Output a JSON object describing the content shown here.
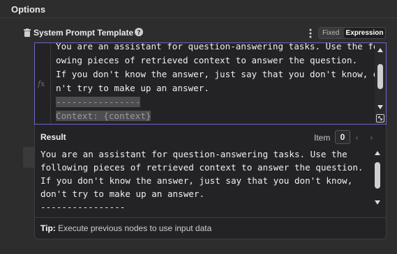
{
  "options": {
    "title": "Options"
  },
  "parameter": {
    "label": "System Prompt Template",
    "mode_fixed": "Fixed",
    "mode_expression": "Expression",
    "active_mode": "Expression"
  },
  "editor": {
    "fx_label": "fx",
    "lines": [
      "You are an assistant for question-answering tasks. Use the foll",
      "owing pieces of retrieved context to answer the question.",
      "If you don't know the answer, just say that you don't know, do",
      "n't try to make up an answer.",
      "----------------",
      "Context: {context}"
    ]
  },
  "result": {
    "title": "Result",
    "item_label": "Item",
    "item_value": "0",
    "lines": [
      "You are an assistant for question-answering tasks. Use the",
      "following pieces of retrieved context to answer the question.",
      "If you don't know the answer, just say that you don't know,",
      "don't try to make up an answer.",
      "----------------"
    ]
  },
  "tip": {
    "label": "Tip:",
    "text": "Execute previous nodes to use input data"
  },
  "colors": {
    "accent": "#6b66c7",
    "background": "#2d2d2e",
    "panel": "#232325"
  }
}
